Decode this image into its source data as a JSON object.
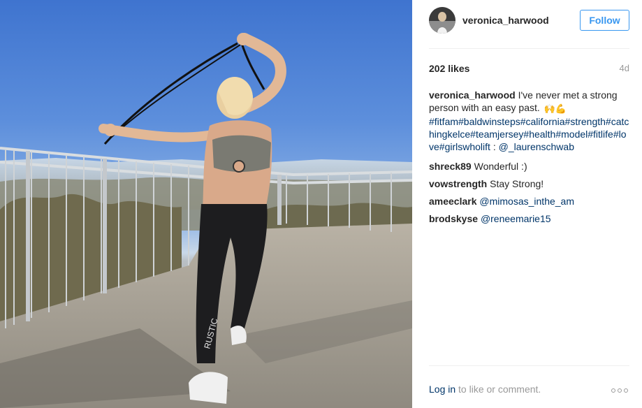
{
  "post": {
    "username": "veronica_harwood",
    "follow_label": "Follow",
    "likes": "202 likes",
    "age": "4d"
  },
  "caption": {
    "user": "veronica_harwood",
    "text": " I've never met a strong person with an easy past. ",
    "emoji": "🙌💪",
    "hashtags": "#fitfam#baldwinsteps#california#strength#catchingkelce#teamjersey#health#model#fitlife#love#girlswholift",
    "separator": " : ",
    "mention": "@_laurenschwab"
  },
  "comments": [
    {
      "user": "shreck89",
      "text": " Wonderful :)",
      "mention": ""
    },
    {
      "user": "vowstrength",
      "text": " Stay Strong!",
      "mention": ""
    },
    {
      "user": "ameeclark",
      "text": " ",
      "mention": "@mimosas_inthe_am"
    },
    {
      "user": "brodskyse",
      "text": " ",
      "mention": "@reneemarie15"
    }
  ],
  "footer": {
    "login_label": "Log in",
    "text": " to like or comment."
  },
  "icons": {
    "more": "more-options-icon"
  },
  "colors": {
    "accent": "#3897f0",
    "link": "#003569",
    "muted": "#999999",
    "text": "#262626"
  }
}
